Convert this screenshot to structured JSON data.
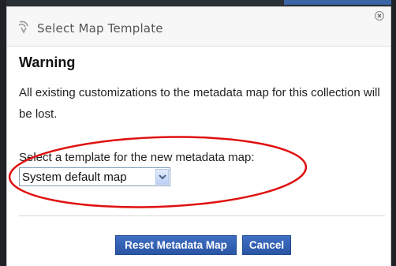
{
  "dialog": {
    "title": "Select Map Template",
    "header_icon": "settings-gear-icon",
    "close_icon": "close-icon"
  },
  "warning": {
    "heading": "Warning",
    "message": "All existing customizations to the metadata map for this collection will be lost."
  },
  "template_select": {
    "label": "Select a template for the new metadata map:",
    "selected_value": "System default map"
  },
  "buttons": {
    "reset_label": "Reset Metadata Map",
    "cancel_label": "Cancel"
  },
  "colors": {
    "button_bg": "#2f5fb3",
    "annotation": "#e01010",
    "title_text": "#555555"
  }
}
